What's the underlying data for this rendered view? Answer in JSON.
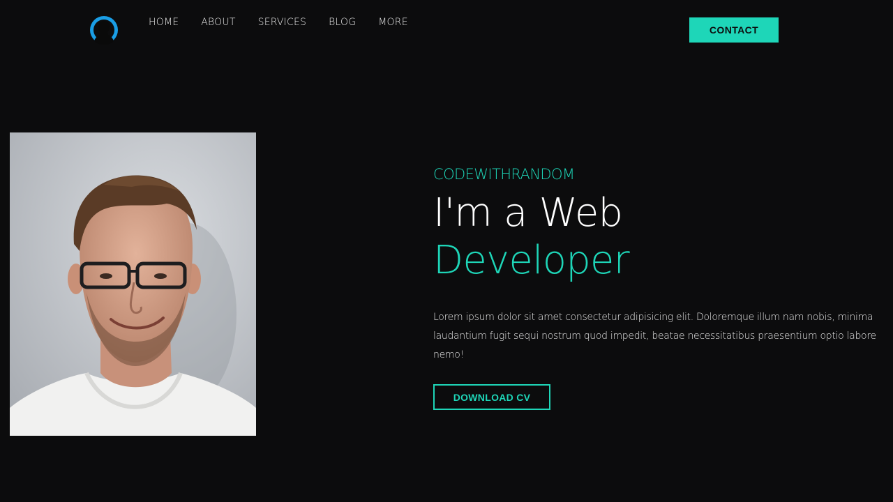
{
  "nav": {
    "logo_icon": "avatar-silhouette-icon",
    "items": [
      {
        "label": "HOME"
      },
      {
        "label": "ABOUT"
      },
      {
        "label": "SERVICES"
      },
      {
        "label": "BLOG"
      },
      {
        "label": "MORE"
      }
    ],
    "contact_label": "CONTACT"
  },
  "hero": {
    "brand": "CODEWITHRANDOM",
    "headline_line1": "I'm a Web",
    "headline_line2": "Developer",
    "description": "Lorem ipsum dolor sit amet consectetur adipisicing elit. Doloremque illum nam nobis, minima laudantium fugit sequi nostrum quod impedit, beatae necessitatibus praesentium optio labore nemo!",
    "cta_label": "DOWNLOAD CV",
    "portrait": "portrait-photo"
  },
  "colors": {
    "background": "#0c0c0d",
    "accent": "#1ed6b8",
    "text": "#ffffff",
    "logo_blue": "#1a9ee6"
  }
}
